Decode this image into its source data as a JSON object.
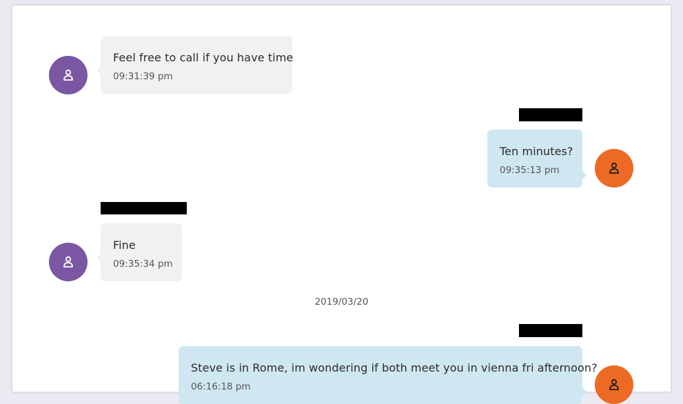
{
  "conversation": {
    "messages": [
      {
        "direction": "incoming",
        "text": "Feel free to call if you have time",
        "time": "09:31:39 pm",
        "avatar_icon": "user-icon"
      },
      {
        "direction": "outgoing",
        "text": "Ten minutes?",
        "time": "09:35:13 pm",
        "avatar_icon": "user-icon"
      },
      {
        "direction": "incoming",
        "text": "Fine",
        "time": "09:35:34 pm",
        "avatar_icon": "user-icon"
      },
      {
        "direction": "outgoing",
        "text": "Steve is in Rome, im wondering if both meet you in vienna fri afternoon?",
        "time": "06:16:18 pm",
        "avatar_icon": "user-icon"
      }
    ],
    "date_separator": "2019/03/20"
  },
  "colors": {
    "incoming_bubble": "#f2f1ef",
    "outgoing_bubble": "#cfe7f1",
    "incoming_avatar": "#7b57a3",
    "outgoing_avatar": "#ec6a23",
    "redaction": "#000000"
  }
}
